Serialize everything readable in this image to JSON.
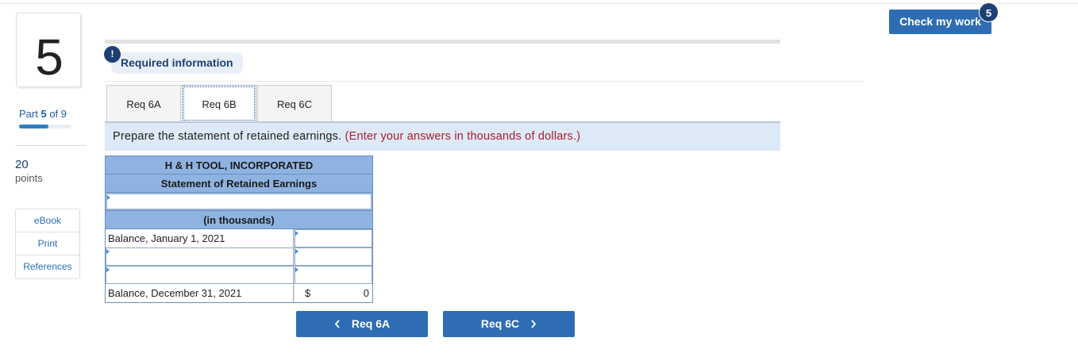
{
  "question": {
    "number": "5"
  },
  "part": {
    "label": "Part",
    "current": "5",
    "of_label": "of 9",
    "progress": 0.56
  },
  "points": {
    "value": "20",
    "label": "points"
  },
  "side_links": [
    "eBook",
    "Print",
    "References"
  ],
  "alert": {
    "icon": "!",
    "label": "Required information"
  },
  "tabs": [
    {
      "label": "Req 6A",
      "active": false
    },
    {
      "label": "Req 6B",
      "active": true
    },
    {
      "label": "Req 6C",
      "active": false
    }
  ],
  "instruction": {
    "text": "Prepare the statement of retained earnings.",
    "note": "(Enter your answers in thousands of dollars.)"
  },
  "statement": {
    "company": "H & H TOOL, INCORPORATED",
    "title": "Statement of Retained Earnings",
    "period_value": "",
    "units": "(in thousands)",
    "rows": [
      {
        "label": "Balance, January 1, 2021",
        "value": ""
      },
      {
        "label": "",
        "value": ""
      },
      {
        "label": "",
        "value": ""
      },
      {
        "label": "Balance, December 31, 2021",
        "currency": "$",
        "value": "0"
      }
    ]
  },
  "nav": {
    "prev_label": "Req 6A",
    "next_label": "Req 6C",
    "prev_icon": "chevron-left-icon",
    "next_icon": "chevron-right-icon"
  },
  "check": {
    "label": "Check my work",
    "badge": "5"
  },
  "colors": {
    "primary": "#2e6db3",
    "navy": "#1d3f73",
    "note_red": "#b01c2e",
    "instruction_bg": "#dde9f6",
    "header_bg": "#8fb3e0"
  }
}
